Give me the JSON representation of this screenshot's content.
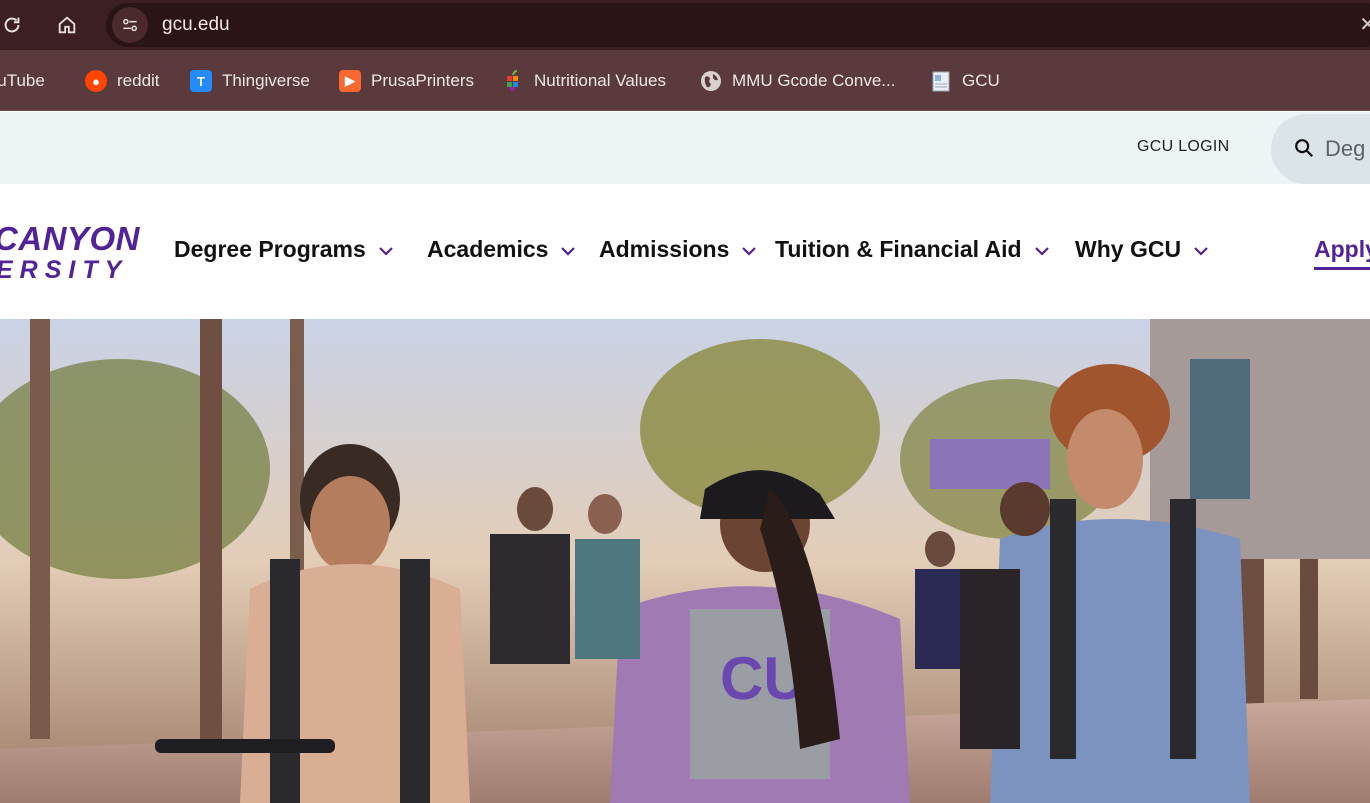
{
  "browser": {
    "url": "gcu.edu",
    "reload_icon": "reload-icon",
    "home_icon": "home-icon",
    "site_info_icon": "tune-icon"
  },
  "bookmarks": [
    {
      "label": "YouTube",
      "icon": "youtube-icon"
    },
    {
      "label": "reddit",
      "icon": "reddit-icon"
    },
    {
      "label": "Thingiverse",
      "icon": "thingiverse-icon"
    },
    {
      "label": "PrusaPrinters",
      "icon": "prusa-icon"
    },
    {
      "label": "Nutritional Values",
      "icon": "apple-icon"
    },
    {
      "label": "MMU Gcode Conve...",
      "icon": "globe-icon"
    },
    {
      "label": "GCU",
      "icon": "document-icon"
    }
  ],
  "utility": {
    "login": "GCU LOGIN",
    "search_placeholder": "Deg"
  },
  "logo": {
    "line1": "CANYON",
    "line2": "ERSITY"
  },
  "nav": {
    "items": [
      {
        "label": "Degree Programs"
      },
      {
        "label": "Academics"
      },
      {
        "label": "Admissions"
      },
      {
        "label": "Tuition & Financial Aid"
      },
      {
        "label": "Why GCU"
      }
    ],
    "apply": "Apply"
  },
  "colors": {
    "brand_purple": "#522398",
    "browser_bg": "#3b1f22",
    "bookmarks_bg": "#5a3a3d",
    "utility_bg": "#edf4f6"
  }
}
